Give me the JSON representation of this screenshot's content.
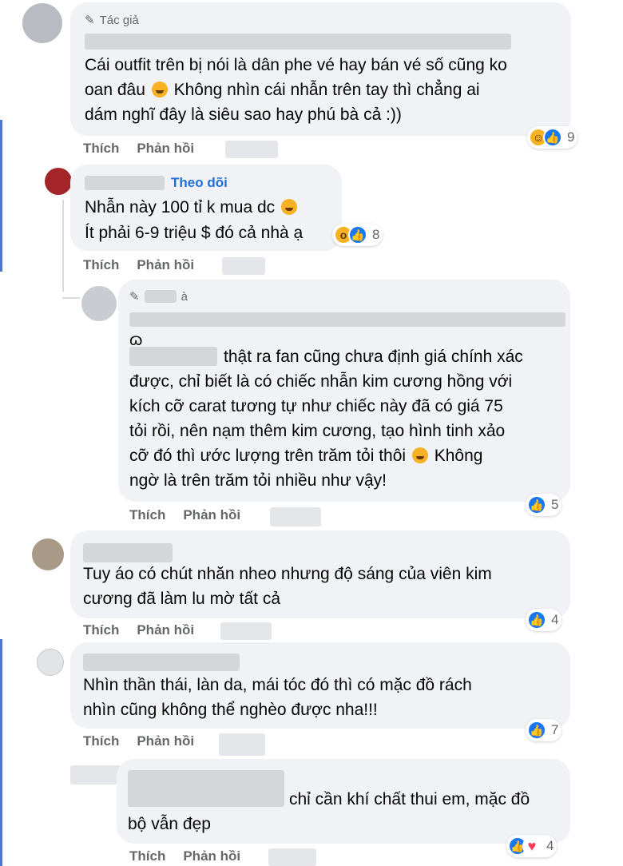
{
  "colors": {
    "bubble": "#f0f2f5",
    "link": "#216fdb",
    "like": "#1877f2",
    "meta": "#65676b"
  },
  "actions": {
    "like": "Thích",
    "reply": "Phản hồi"
  },
  "comments": [
    {
      "author_tag": "Tác giả",
      "lines": [
        "Cái outfit trên bị nói là dân phe vé hay bán vé số cũng ko",
        "oan đâu",
        "Không nhìn cái nhẫn trên tay thì chẳng ai",
        "dám nghĩ đây là siêu sao hay phú bà cả :))"
      ],
      "reaction_count": "9",
      "reaction_icons": [
        "haha-icon",
        "like-icon"
      ]
    },
    {
      "follow_label": "Theo dõi",
      "lines": [
        "Nhẫn này 100 tỉ k mua dc",
        "Ít phải 6-9 triệu $ đó cả nhà ạ"
      ],
      "reaction_count": "8",
      "reaction_icons": [
        "wow-icon",
        "like-icon"
      ]
    },
    {
      "author_tag": "à",
      "lines": [
        "thật ra fan cũng chưa định giá chính xác",
        "được, chỉ biết là có chiếc nhẫn kim cương hồng với",
        "kích cỡ carat tương tự như chiếc này đã có giá 75",
        "tỏi rồi, nên nạm thêm kim cương, tạo hình tinh xảo",
        "cỡ đó thì ước lượng trên trăm tỏi thôi",
        "Không",
        "ngờ là trên trăm tỏi nhiều như vậy!"
      ],
      "reaction_count": "5",
      "reaction_icons": [
        "like-icon"
      ]
    },
    {
      "lines": [
        "Tuy áo có chút nhăn nheo nhưng độ sáng của viên kim",
        "cương đã làm lu mờ tất cả"
      ],
      "reaction_count": "4",
      "reaction_icons": [
        "like-icon"
      ]
    },
    {
      "lines": [
        "Nhìn thần thái, làn da, mái tóc đó thì có mặc đồ rách",
        "nhìn cũng không thể nghèo được nha!!!"
      ],
      "reaction_count": "7",
      "reaction_icons": [
        "like-icon"
      ]
    },
    {
      "lines": [
        "chỉ cần khí chất thui em, mặc đồ",
        "bộ vẫn đẹp"
      ],
      "reaction_count": "4",
      "reaction_icons": [
        "like-icon",
        "love-icon"
      ]
    }
  ]
}
